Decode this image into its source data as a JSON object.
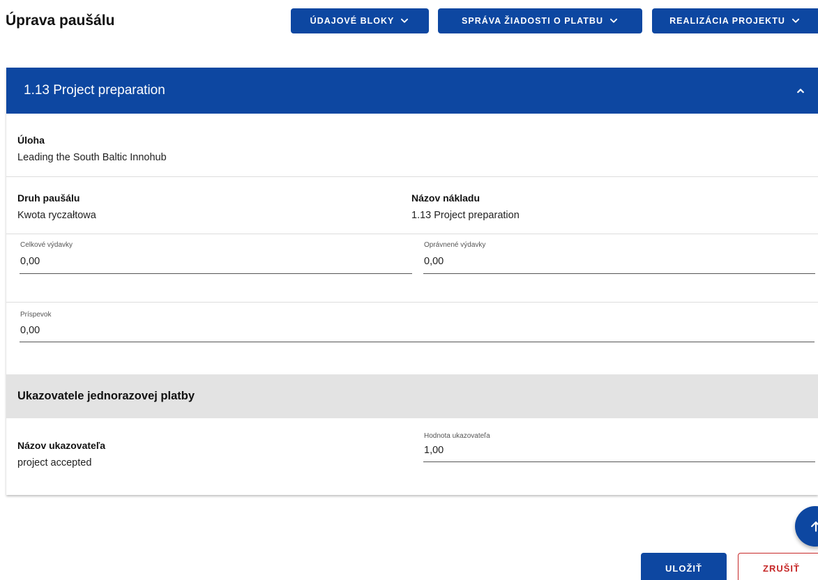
{
  "page": {
    "title": "Úprava paušálu"
  },
  "toolbar": {
    "buttons": [
      {
        "label": "ÚDAJOVÉ BLOKY",
        "icon": "chevron-down-icon"
      },
      {
        "label": "SPRÁVA ŽIADOSTI O PLATBU",
        "icon": "chevron-down-icon"
      },
      {
        "label": "REALIZÁCIA PROJEKTU",
        "icon": "chevron-down-icon"
      }
    ]
  },
  "card": {
    "title": "1.13 Project preparation",
    "collapse_icon": "chevron-up-icon",
    "task": {
      "label": "Úloha",
      "value": "Leading the South Baltic Innohub"
    },
    "lump_type": {
      "label": "Druh paušálu",
      "value": "Kwota ryczałtowa"
    },
    "cost_name": {
      "label": "Názov nákladu",
      "value": "1.13 Project preparation"
    },
    "total_expenses": {
      "label": "Celkové výdavky",
      "value": "0,00"
    },
    "eligible_expenses": {
      "label": "Oprávnené výdavky",
      "value": "0,00"
    },
    "contribution": {
      "label": "Príspevok",
      "value": "0,00"
    },
    "indicators_section": {
      "title": "Ukazovatele jednorazovej platby"
    },
    "indicator_name": {
      "label": "Názov ukazovateľa",
      "value": "project accepted"
    },
    "indicator_value": {
      "label": "Hodnota ukazovateľa",
      "value": "1,00"
    }
  },
  "fab": {
    "icon": "arrow-up-icon"
  },
  "actions": {
    "save_label": "ULOŽIŤ",
    "cancel_label": "ZRUŠIŤ"
  },
  "colors": {
    "primary": "#0d47a1",
    "danger": "#c62828",
    "section_band": "#e3e3e3"
  }
}
